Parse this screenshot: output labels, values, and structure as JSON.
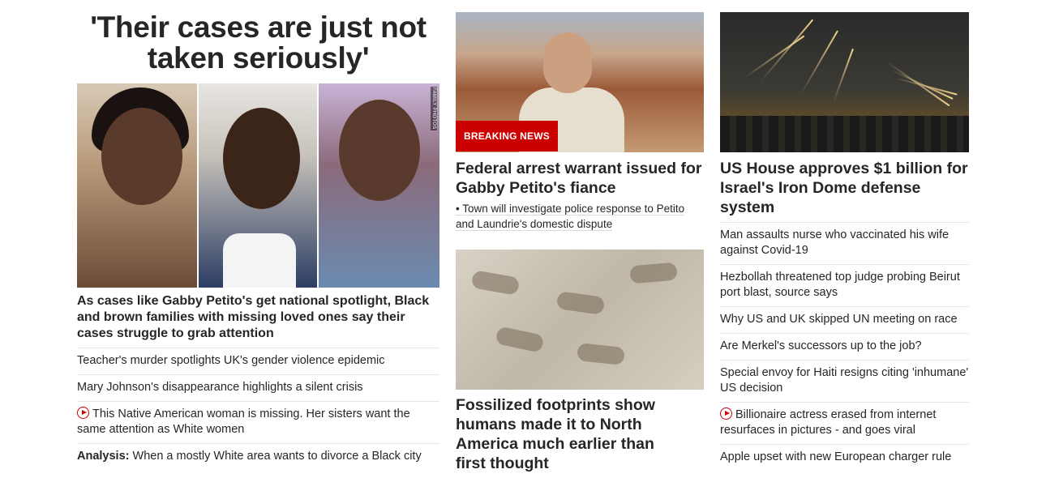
{
  "col1": {
    "headline": "'Their cases are just not taken seriously'",
    "photo_credit": "FAMILY PHOTOS",
    "lead": "As cases like Gabby Petito's get national spotlight, Black and brown families with missing loved ones say their cases struggle to grab attention",
    "links": [
      {
        "text": "Teacher's murder spotlights UK's gender violence epidemic"
      },
      {
        "text": "Mary Johnson's disappearance highlights a silent crisis"
      },
      {
        "text": "This Native American woman is missing. Her sisters want the same attention as White women",
        "video": true
      },
      {
        "prefix": "Analysis:",
        "text": " When a mostly White area wants to divorce a Black city"
      }
    ]
  },
  "col2": {
    "badge": "BREAKING NEWS",
    "headline": "Federal arrest warrant issued for Gabby Petito's fiance",
    "bullet": "• Town will investigate police response to Petito and Laundrie's domestic dispute",
    "headline2": "Fossilized footprints show humans made it to North America much earlier than first thought"
  },
  "col3": {
    "headline": "US House approves $1 billion for Israel's Iron Dome defense system",
    "links": [
      {
        "text": "Man assaults nurse who vaccinated his wife against Covid-19"
      },
      {
        "text": "Hezbollah threatened top judge probing Beirut port blast, source says"
      },
      {
        "text": "Why US and UK skipped UN meeting on race"
      },
      {
        "text": "Are Merkel's successors up to the job?"
      },
      {
        "text": "Special envoy for Haiti resigns citing 'inhumane' US decision"
      },
      {
        "text": "Billionaire actress erased from internet resurfaces in pictures - and goes viral",
        "video": true
      },
      {
        "text": "Apple upset with new European charger rule"
      }
    ]
  },
  "colors": {
    "accent_red": "#cc0000",
    "text": "#262626",
    "divider": "#e6e6e6"
  }
}
